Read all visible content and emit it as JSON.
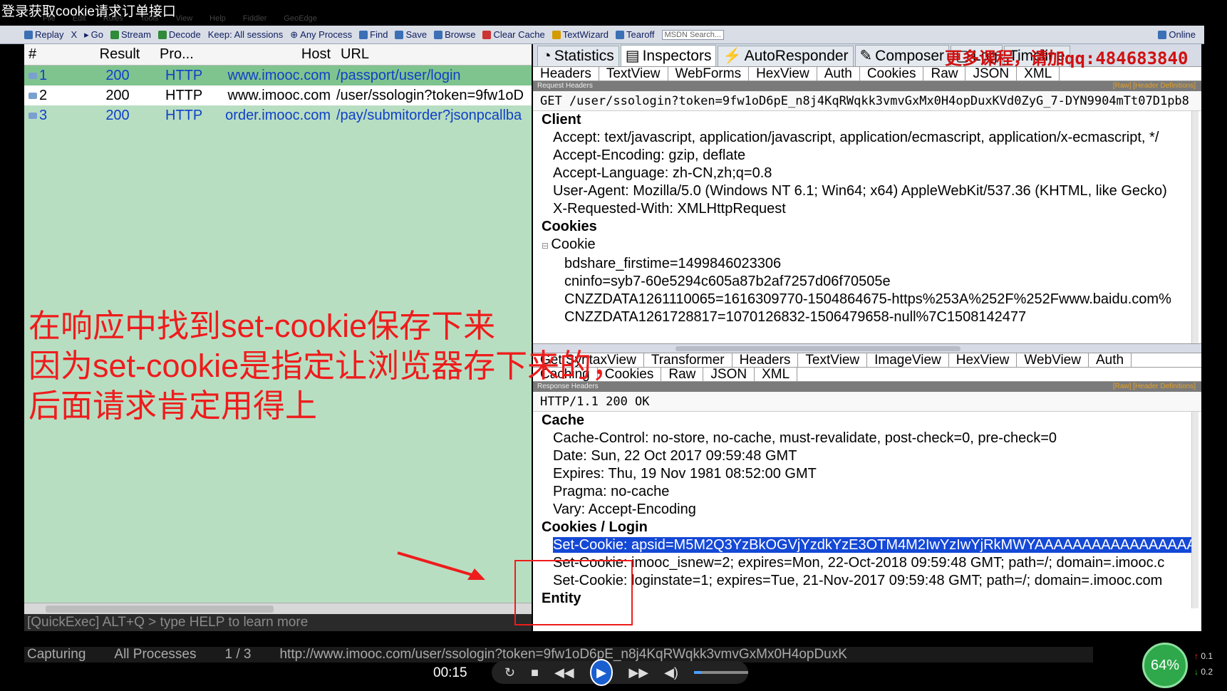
{
  "video_title": "登录获取cookie请求订单接口",
  "menu": [
    "File",
    "Edit",
    "Rules",
    "Tools",
    "View",
    "Help",
    "Fiddler",
    "GeoEdge"
  ],
  "toolbar": {
    "items": [
      "Replay",
      "X",
      "Go",
      "Stream",
      "Decode",
      "Keep: All sessions",
      "Any Process",
      "Find",
      "Save",
      "Browse",
      "Clear Cache",
      "TextWizard",
      "Tearoff"
    ],
    "search_placeholder": "MSDN Search...",
    "online": "Online"
  },
  "sessions": {
    "headers": [
      "#",
      "Result",
      "Pro...",
      "Host",
      "URL"
    ],
    "rows": [
      {
        "num": "1",
        "result": "200",
        "protocol": "HTTP",
        "host": "www.imooc.com",
        "url": "/passport/user/login"
      },
      {
        "num": "2",
        "result": "200",
        "protocol": "HTTP",
        "host": "www.imooc.com",
        "url": "/user/ssologin?token=9fw1oD"
      },
      {
        "num": "3",
        "result": "200",
        "protocol": "HTTP",
        "host": "order.imooc.com",
        "url": "/pay/submitorder?jsonpcallba"
      }
    ]
  },
  "quickexec": "[QuickExec] ALT+Q > type HELP to learn more",
  "inspector": {
    "main_tabs": [
      "Statistics",
      "Inspectors",
      "AutoResponder",
      "Composer",
      "Log",
      "Timeline"
    ],
    "request_tabs": [
      "Headers",
      "TextView",
      "WebForms",
      "HexView",
      "Auth",
      "Cookies",
      "Raw",
      "JSON",
      "XML"
    ],
    "request_bar": "Request Headers",
    "bar_links": "[Raw]  [Header Definitions]",
    "request_line": "GET /user/ssologin?token=9fw1oD6pE_n8j4KqRWqkk3vmvGxMx0H4opDuxKVd0ZyG_7-DYN9904mTt07D1pb8",
    "client_section": "Client",
    "client_headers": [
      "Accept: text/javascript, application/javascript, application/ecmascript, application/x-ecmascript, */",
      "Accept-Encoding: gzip, deflate",
      "Accept-Language: zh-CN,zh;q=0.8",
      "User-Agent: Mozilla/5.0 (Windows NT 6.1; Win64; x64) AppleWebKit/537.36 (KHTML, like Gecko)",
      "X-Requested-With: XMLHttpRequest"
    ],
    "cookies_section": "Cookies",
    "cookie_node": "Cookie",
    "cookie_values": [
      "bdshare_firstime=1499846023306",
      "cninfo=syb7-60e5294c605a87b2af7257d06f70505e",
      "CNZZDATA1261110065=1616309770-1504864675-https%253A%252F%252Fwww.baidu.com%",
      "CNZZDATA1261728817=1070126832-1506479658-null%7C1508142477"
    ],
    "response_tabs_1": [
      "Get SyntaxView",
      "Transformer",
      "Headers",
      "TextView",
      "ImageView",
      "HexView",
      "WebView",
      "Auth"
    ],
    "response_tabs_2": [
      "Caching",
      "Cookies",
      "Raw",
      "JSON",
      "XML"
    ],
    "response_bar": "Response Headers",
    "response_line": "HTTP/1.1 200 OK",
    "cache_section": "Cache",
    "cache_headers": [
      "Cache-Control: no-store, no-cache, must-revalidate, post-check=0, pre-check=0",
      "Date: Sun, 22 Oct 2017 09:59:48 GMT",
      "Expires: Thu, 19 Nov 1981 08:52:00 GMT",
      "Pragma: no-cache",
      "Vary: Accept-Encoding"
    ],
    "cookies_login_section": "Cookies / Login",
    "set_cookies": [
      "Set-Cookie: apsid=M5M2Q3YzBkOGVjYzdkYzE3OTM4M2IwYzIwYjRkMWYAAAAAAAAAAAAAAAAA",
      "Set-Cookie: imooc_isnew=2; expires=Mon, 22-Oct-2018 09:59:48 GMT; path=/; domain=.imooc.c",
      "Set-Cookie: loginstate=1; expires=Tue, 21-Nov-2017 09:59:48 GMT; path=/; domain=.imooc.com"
    ],
    "entity_section": "Entity"
  },
  "annotation": {
    "line1": "在响应中找到set-cookie保存下来",
    "line2": "因为set-cookie是指定让浏览器存下来的，",
    "line3": "后面请求肯定用得上"
  },
  "promo": "更多课程，请加qq:484683840",
  "statusbar": {
    "capturing": "Capturing",
    "processes": "All Processes",
    "count": "1 / 3",
    "url": "http://www.imooc.com/user/ssologin?token=9fw1oD6pE_n8j4KqRWqkk3vmvGxMx0H4opDuxK"
  },
  "player": {
    "time": "00:15",
    "volume_fraction": 0.15,
    "cpu_badge": "64%",
    "speed_up": "0.1",
    "speed_down": "0.2"
  },
  "colors": {
    "session_bg": "#b8dec2",
    "highlight": "#1448d6",
    "annotation": "#ee1c1c"
  }
}
